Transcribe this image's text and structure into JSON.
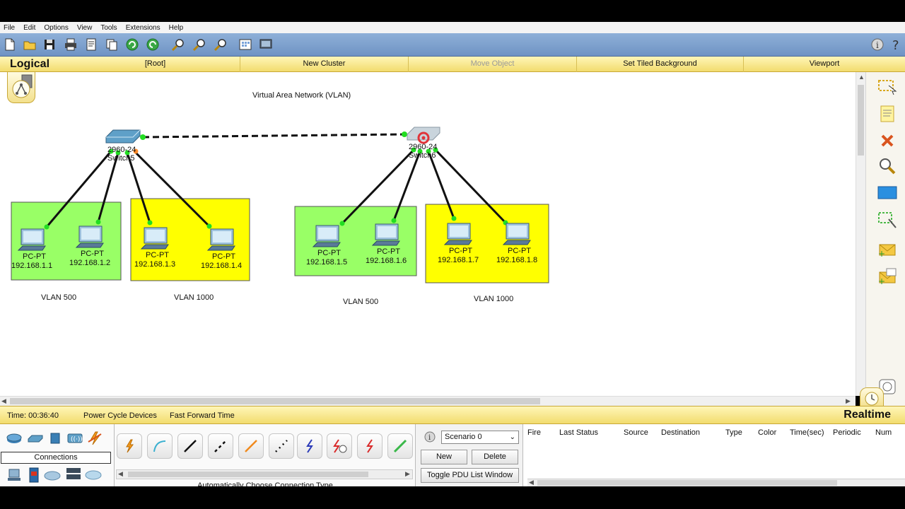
{
  "menu": [
    "File",
    "Edit",
    "Options",
    "View",
    "Tools",
    "Extensions",
    "Help"
  ],
  "workspace_bar": {
    "mode": "Logical",
    "root": "[Root]",
    "new_cluster": "New Cluster",
    "move_object": "Move Object",
    "set_tiled_background": "Set Tiled Background",
    "viewport": "Viewport"
  },
  "canvas": {
    "title": "Virtual Area Network (VLAN)",
    "switches": [
      {
        "model": "2960-24",
        "name": "Switch5"
      },
      {
        "model": "2960-24",
        "name": "Switch6"
      }
    ],
    "pcs": [
      {
        "type": "PC-PT",
        "ip": "192.168.1.1"
      },
      {
        "type": "PC-PT",
        "ip": "192.168.1.2"
      },
      {
        "type": "PC-PT",
        "ip": "192.168.1.3"
      },
      {
        "type": "PC-PT",
        "ip": "192.168.1.4"
      },
      {
        "type": "PC-PT",
        "ip": "192.168.1.5"
      },
      {
        "type": "PC-PT",
        "ip": "192.168.1.6"
      },
      {
        "type": "PC-PT",
        "ip": "192.168.1.7"
      },
      {
        "type": "PC-PT",
        "ip": "192.168.1.8"
      }
    ],
    "vlan_labels": [
      "VLAN 500",
      "VLAN 1000",
      "VLAN 500",
      "VLAN 1000"
    ],
    "colors": {
      "vlan500": "#99ff66",
      "vlan1000": "#ffff00",
      "link_up": "#22dd22",
      "link": "#111111"
    }
  },
  "status": {
    "time": "Time: 00:36:40",
    "power_cycle": "Power Cycle Devices",
    "fast_forward": "Fast Forward Time",
    "mode": "Realtime"
  },
  "device_panel": {
    "category_label": "Connections",
    "top_icons": [
      "router-icon",
      "switch-icon",
      "hub-icon",
      "wireless-icon",
      "connections-icon"
    ],
    "bottom_icons": [
      "end-device-icon",
      "custom-device-icon",
      "cloud-icon",
      "multiuser-icon",
      "wan-emulation-icon"
    ],
    "connection_types": [
      "auto-connection-icon",
      "console-cable-icon",
      "copper-straight-icon",
      "copper-cross-icon",
      "fiber-icon",
      "phone-cable-icon",
      "coaxial-icon",
      "serial-dce-icon",
      "serial-dte-icon",
      "octal-cable-icon"
    ],
    "auto_label": "Automatically Choose Connection Type"
  },
  "scenario": {
    "selected": "Scenario 0",
    "new_label": "New",
    "delete_label": "Delete",
    "toggle_label": "Toggle PDU List Window"
  },
  "pdu_headers": [
    "Fire",
    "Last Status",
    "Source",
    "Destination",
    "Type",
    "Color",
    "Time(sec)",
    "Periodic",
    "Num"
  ]
}
